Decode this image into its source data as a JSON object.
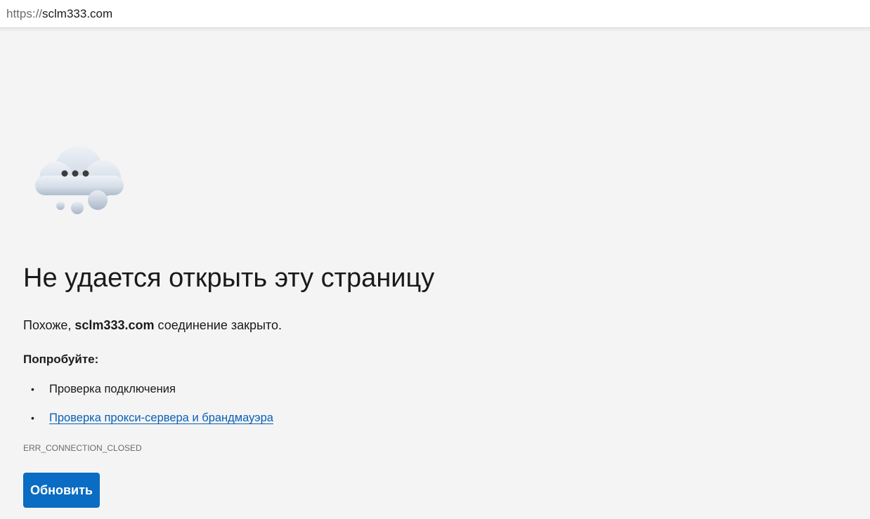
{
  "address_bar": {
    "scheme": "https://",
    "host": "sclm333.com"
  },
  "error": {
    "title": "Не удается открыть эту страницу",
    "message_prefix": "Похоже, ",
    "message_host": "sclm333.com",
    "message_suffix": " соединение закрыто.",
    "try_label": "Попробуйте:",
    "suggestions": [
      {
        "label": "Проверка подключения",
        "is_link": false
      },
      {
        "label": "Проверка прокси-сервера и брандмауэра",
        "is_link": true
      }
    ],
    "bullet": "•",
    "code": "ERR_CONNECTION_CLOSED",
    "refresh_label": "Обновить"
  },
  "icons": {
    "cloud": "cloud-offline-icon"
  },
  "colors": {
    "background": "#f4f4f4",
    "link": "#0a5fb4",
    "button": "#0a6cc2"
  }
}
